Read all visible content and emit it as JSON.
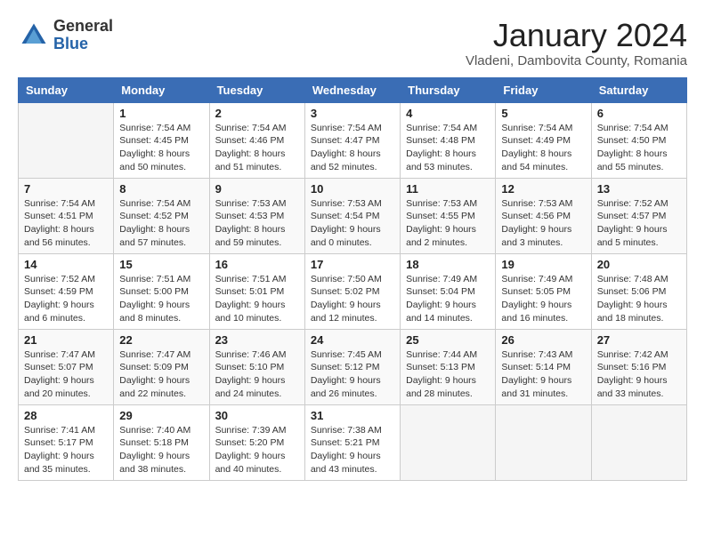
{
  "header": {
    "logo_general": "General",
    "logo_blue": "Blue",
    "month_year": "January 2024",
    "location": "Vladeni, Dambovita County, Romania"
  },
  "days_of_week": [
    "Sunday",
    "Monday",
    "Tuesday",
    "Wednesday",
    "Thursday",
    "Friday",
    "Saturday"
  ],
  "weeks": [
    [
      {
        "day": "",
        "info": ""
      },
      {
        "day": "1",
        "info": "Sunrise: 7:54 AM\nSunset: 4:45 PM\nDaylight: 8 hours\nand 50 minutes."
      },
      {
        "day": "2",
        "info": "Sunrise: 7:54 AM\nSunset: 4:46 PM\nDaylight: 8 hours\nand 51 minutes."
      },
      {
        "day": "3",
        "info": "Sunrise: 7:54 AM\nSunset: 4:47 PM\nDaylight: 8 hours\nand 52 minutes."
      },
      {
        "day": "4",
        "info": "Sunrise: 7:54 AM\nSunset: 4:48 PM\nDaylight: 8 hours\nand 53 minutes."
      },
      {
        "day": "5",
        "info": "Sunrise: 7:54 AM\nSunset: 4:49 PM\nDaylight: 8 hours\nand 54 minutes."
      },
      {
        "day": "6",
        "info": "Sunrise: 7:54 AM\nSunset: 4:50 PM\nDaylight: 8 hours\nand 55 minutes."
      }
    ],
    [
      {
        "day": "7",
        "info": "Sunrise: 7:54 AM\nSunset: 4:51 PM\nDaylight: 8 hours\nand 56 minutes."
      },
      {
        "day": "8",
        "info": "Sunrise: 7:54 AM\nSunset: 4:52 PM\nDaylight: 8 hours\nand 57 minutes."
      },
      {
        "day": "9",
        "info": "Sunrise: 7:53 AM\nSunset: 4:53 PM\nDaylight: 8 hours\nand 59 minutes."
      },
      {
        "day": "10",
        "info": "Sunrise: 7:53 AM\nSunset: 4:54 PM\nDaylight: 9 hours\nand 0 minutes."
      },
      {
        "day": "11",
        "info": "Sunrise: 7:53 AM\nSunset: 4:55 PM\nDaylight: 9 hours\nand 2 minutes."
      },
      {
        "day": "12",
        "info": "Sunrise: 7:53 AM\nSunset: 4:56 PM\nDaylight: 9 hours\nand 3 minutes."
      },
      {
        "day": "13",
        "info": "Sunrise: 7:52 AM\nSunset: 4:57 PM\nDaylight: 9 hours\nand 5 minutes."
      }
    ],
    [
      {
        "day": "14",
        "info": "Sunrise: 7:52 AM\nSunset: 4:59 PM\nDaylight: 9 hours\nand 6 minutes."
      },
      {
        "day": "15",
        "info": "Sunrise: 7:51 AM\nSunset: 5:00 PM\nDaylight: 9 hours\nand 8 minutes."
      },
      {
        "day": "16",
        "info": "Sunrise: 7:51 AM\nSunset: 5:01 PM\nDaylight: 9 hours\nand 10 minutes."
      },
      {
        "day": "17",
        "info": "Sunrise: 7:50 AM\nSunset: 5:02 PM\nDaylight: 9 hours\nand 12 minutes."
      },
      {
        "day": "18",
        "info": "Sunrise: 7:49 AM\nSunset: 5:04 PM\nDaylight: 9 hours\nand 14 minutes."
      },
      {
        "day": "19",
        "info": "Sunrise: 7:49 AM\nSunset: 5:05 PM\nDaylight: 9 hours\nand 16 minutes."
      },
      {
        "day": "20",
        "info": "Sunrise: 7:48 AM\nSunset: 5:06 PM\nDaylight: 9 hours\nand 18 minutes."
      }
    ],
    [
      {
        "day": "21",
        "info": "Sunrise: 7:47 AM\nSunset: 5:07 PM\nDaylight: 9 hours\nand 20 minutes."
      },
      {
        "day": "22",
        "info": "Sunrise: 7:47 AM\nSunset: 5:09 PM\nDaylight: 9 hours\nand 22 minutes."
      },
      {
        "day": "23",
        "info": "Sunrise: 7:46 AM\nSunset: 5:10 PM\nDaylight: 9 hours\nand 24 minutes."
      },
      {
        "day": "24",
        "info": "Sunrise: 7:45 AM\nSunset: 5:12 PM\nDaylight: 9 hours\nand 26 minutes."
      },
      {
        "day": "25",
        "info": "Sunrise: 7:44 AM\nSunset: 5:13 PM\nDaylight: 9 hours\nand 28 minutes."
      },
      {
        "day": "26",
        "info": "Sunrise: 7:43 AM\nSunset: 5:14 PM\nDaylight: 9 hours\nand 31 minutes."
      },
      {
        "day": "27",
        "info": "Sunrise: 7:42 AM\nSunset: 5:16 PM\nDaylight: 9 hours\nand 33 minutes."
      }
    ],
    [
      {
        "day": "28",
        "info": "Sunrise: 7:41 AM\nSunset: 5:17 PM\nDaylight: 9 hours\nand 35 minutes."
      },
      {
        "day": "29",
        "info": "Sunrise: 7:40 AM\nSunset: 5:18 PM\nDaylight: 9 hours\nand 38 minutes."
      },
      {
        "day": "30",
        "info": "Sunrise: 7:39 AM\nSunset: 5:20 PM\nDaylight: 9 hours\nand 40 minutes."
      },
      {
        "day": "31",
        "info": "Sunrise: 7:38 AM\nSunset: 5:21 PM\nDaylight: 9 hours\nand 43 minutes."
      },
      {
        "day": "",
        "info": ""
      },
      {
        "day": "",
        "info": ""
      },
      {
        "day": "",
        "info": ""
      }
    ]
  ]
}
